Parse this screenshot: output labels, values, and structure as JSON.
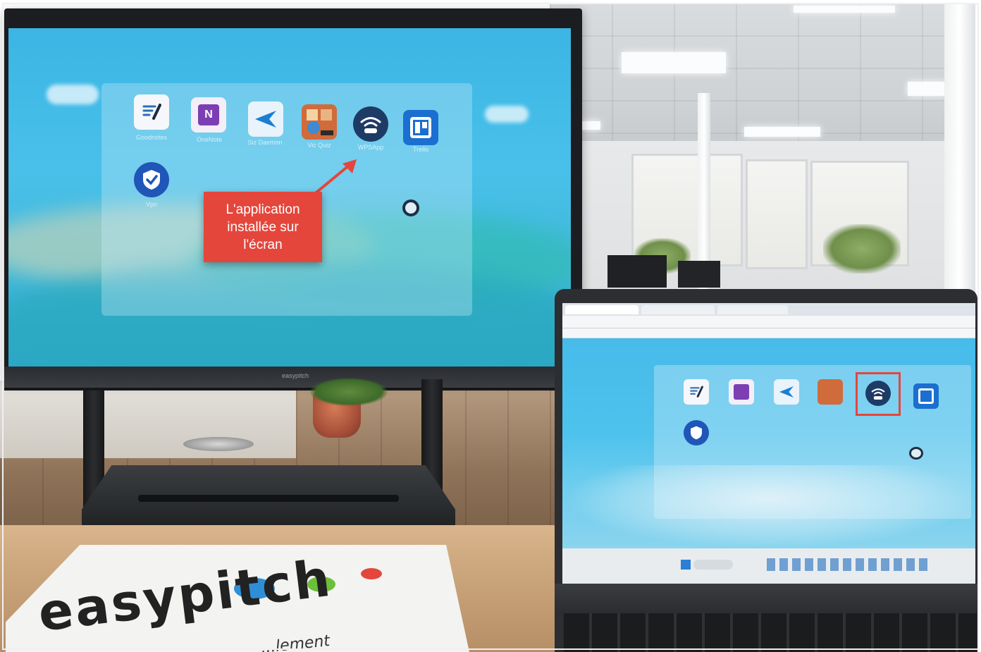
{
  "callout": {
    "line1": "L'application",
    "line2": "installée sur",
    "line3": "l'écran"
  },
  "tv": {
    "apps": [
      {
        "label": "Goodnotes",
        "icon": "goodnotes-icon"
      },
      {
        "label": "OneNote",
        "icon": "onenote-icon"
      },
      {
        "label": "Siz Daemon",
        "icon": "arrow-app-icon"
      },
      {
        "label": "Vic Quiz",
        "icon": "game-app-icon"
      },
      {
        "label": "WPSApp",
        "icon": "wps-wifi-icon"
      },
      {
        "label": "Trello",
        "icon": "trello-icon"
      },
      {
        "label": "Vpn",
        "icon": "shield-check-icon"
      }
    ],
    "bezel_brand": "easypitch"
  },
  "sheet": {
    "brand": "easypitch",
    "subtitle": "...lement",
    "dot_colors": [
      "#2f8fd6",
      "#6cbf3a",
      "#e4463c"
    ]
  },
  "colors": {
    "callout_bg": "#e4463c",
    "highlight": "#e4463c",
    "wallpaper": "#3cb5e4"
  }
}
